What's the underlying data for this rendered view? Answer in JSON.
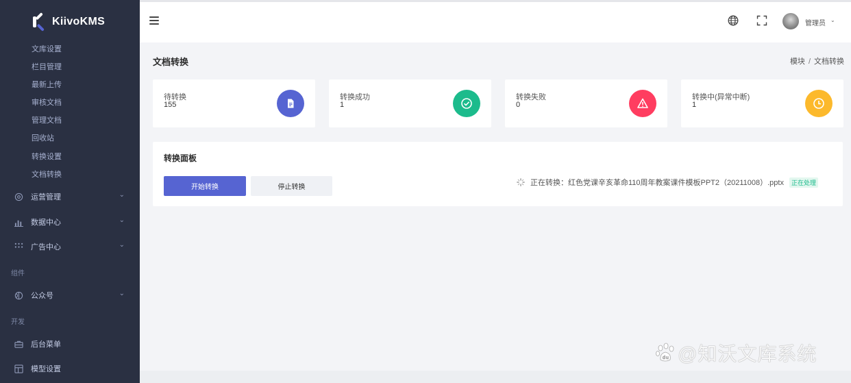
{
  "app": {
    "name": "KiivoKMS"
  },
  "sidebar": {
    "sub_items": [
      "文库设置",
      "栏目管理",
      "最新上传",
      "审核文档",
      "管理文档",
      "回收站",
      "转换设置",
      "文档转换"
    ],
    "menu": [
      {
        "label": "运营管理",
        "icon": "operations-icon"
      },
      {
        "label": "数据中心",
        "icon": "bar-chart-icon"
      },
      {
        "label": "广告中心",
        "icon": "grid-dots-icon"
      }
    ],
    "section_components": "组件",
    "public_account": {
      "label": "公众号",
      "icon": "wechat-icon"
    },
    "section_dev": "开发",
    "admin_menu": {
      "label": "后台菜单",
      "icon": "briefcase-icon"
    },
    "model_settings": {
      "label": "模型设置",
      "icon": "layout-icon"
    }
  },
  "topbar": {
    "user_name": "管理员"
  },
  "page": {
    "title": "文档转换",
    "breadcrumb": [
      "模块",
      "文档转换"
    ]
  },
  "stats": [
    {
      "label": "待转换",
      "value": "155",
      "icon": "document-icon",
      "color": "#5664d2"
    },
    {
      "label": "转换成功",
      "value": "1",
      "icon": "check-circle-icon",
      "color": "#1cbb8c"
    },
    {
      "label": "转换失败",
      "value": "0",
      "icon": "warning-icon",
      "color": "#ff3d60"
    },
    {
      "label": "转换中(异常中断)",
      "value": "1",
      "icon": "clock-icon",
      "color": "#fcb92c"
    }
  ],
  "panel": {
    "title": "转换面板",
    "start_label": "开始转换",
    "stop_label": "停止转换",
    "status_text": "正在转换：红色党课辛亥革命110周年教案课件模板PPT2（20211008）.pptx",
    "status_badge": "正在处理"
  },
  "watermark": {
    "text": "@知沃文库系统"
  }
}
